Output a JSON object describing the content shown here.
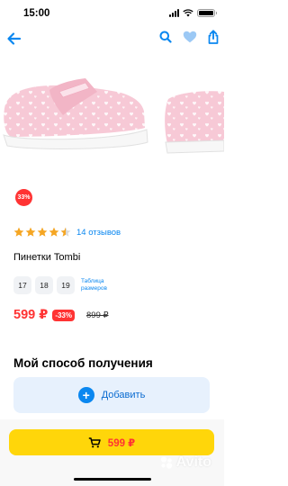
{
  "status_bar": {
    "time": "15:00"
  },
  "nav": {
    "back_icon": "arrow-left-icon",
    "search_icon": "search-icon",
    "favorite_icon": "heart-icon",
    "share_icon": "share-icon"
  },
  "product": {
    "discount_badge": "33%",
    "rating_value": 4.5,
    "reviews_text": "14 отзывов",
    "title": "Пинетки Tombi",
    "sizes": [
      "17",
      "18",
      "19"
    ],
    "size_table_label": "Таблица размеров",
    "price_current": "599 ₽",
    "discount": "-33%",
    "price_old": "899 ₽"
  },
  "delivery": {
    "heading": "Мой способ получения",
    "add_label": "Добавить"
  },
  "buy_bar": {
    "price": "599 ₽",
    "cart_icon": "cart-icon"
  },
  "watermark": "Avito",
  "colors": {
    "accent_blue": "#0a87f0",
    "price_red": "#ff3333",
    "buy_yellow": "#ffd60a",
    "star_gold": "#f5a623"
  }
}
